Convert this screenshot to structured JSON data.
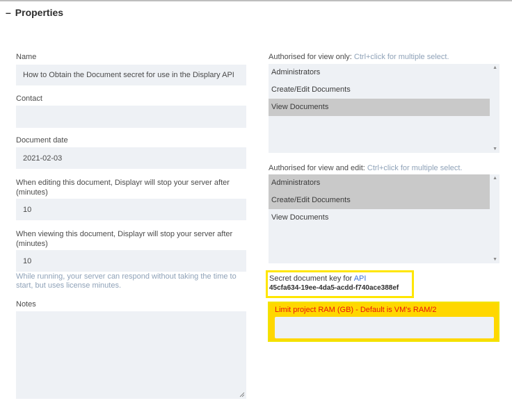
{
  "header": {
    "toggle": "–",
    "title": "Properties"
  },
  "left": {
    "name_label": "Name",
    "name_value": "How to Obtain the Document secret for use in the Displary API",
    "contact_label": "Contact",
    "contact_value": "",
    "date_label": "Document date",
    "date_value": "2021-02-03",
    "edit_timeout_label": "When editing this document, Displayr will stop your server after (minutes)",
    "edit_timeout_value": "10",
    "view_timeout_label": "When viewing this document, Displayr will stop your server after (minutes)",
    "view_timeout_value": "10",
    "running_hint": "While running, your server can respond without taking the time to start, but uses license minutes.",
    "notes_label": "Notes",
    "notes_value": ""
  },
  "right": {
    "view_only_label": "Authorised for view only:",
    "view_only_hint": "Ctrl+click for multiple select.",
    "view_only_options": [
      {
        "label": "Administrators"
      },
      {
        "label": "Create/Edit Documents"
      },
      {
        "label": "View Documents"
      }
    ],
    "view_edit_label": "Authorised for view and edit:",
    "view_edit_hint": "Ctrl+click for multiple select.",
    "view_edit_options": [
      {
        "label": "Administrators"
      },
      {
        "label": "Create/Edit Documents"
      },
      {
        "label": "View Documents"
      }
    ],
    "secret_label": "Secret document key for",
    "secret_api_link": "API",
    "secret_key": "45cfa634-19ee-4da5-acdd-f740ace388ef",
    "ram_label": "Limit project RAM (GB) - Default is VM's RAM/2",
    "ram_value": ""
  },
  "colors": {
    "highlight_yellow": "#ffe600",
    "ram_panel": "#ffd700",
    "ram_label": "#e8110e",
    "hint": "#8fa2b8",
    "field_bg": "#eef1f5",
    "selected_option": "#c9c9c9"
  },
  "icons": {
    "toggle": "collapse-dash-icon",
    "scroll_up": "scroll-up-arrow-icon",
    "scroll_down": "scroll-down-arrow-icon",
    "resize": "resize-grip-icon"
  }
}
